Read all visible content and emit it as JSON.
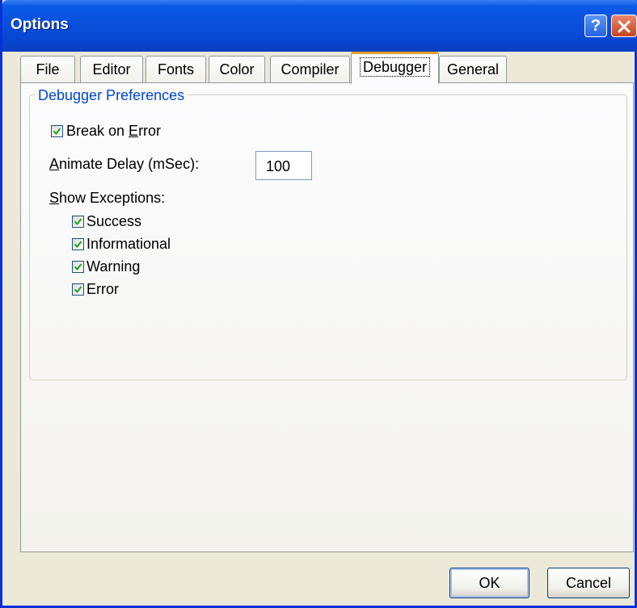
{
  "window": {
    "title": "Options",
    "help_button": "?",
    "close_button": "×"
  },
  "tabs": [
    {
      "label": "File"
    },
    {
      "label": "Editor"
    },
    {
      "label": "Fonts"
    },
    {
      "label": "Color"
    },
    {
      "label": "Compiler"
    },
    {
      "label": "Debugger"
    },
    {
      "label": "General"
    }
  ],
  "active_tab": "Debugger",
  "group": {
    "title": "Debugger Preferences"
  },
  "break_on_error": {
    "label_prefix": "Break on ",
    "label_mnemonic": "E",
    "label_suffix": "rror",
    "checked": true
  },
  "animate_delay": {
    "label_mnemonic": "A",
    "label_suffix": "nimate Delay (mSec):",
    "value": "100"
  },
  "show_exceptions": {
    "label_mnemonic": "S",
    "label_suffix": "how Exceptions:",
    "items": [
      {
        "label": "Success",
        "checked": true
      },
      {
        "label": "Informational",
        "checked": true
      },
      {
        "label": "Warning",
        "checked": true
      },
      {
        "label": "Error",
        "checked": true
      }
    ]
  },
  "buttons": {
    "ok": "OK",
    "cancel": "Cancel"
  },
  "colors": {
    "titlebar": "#0a52dd",
    "group_title": "#0046d5",
    "check_mark": "#21a121",
    "active_tab_accent": "#e6a027"
  }
}
